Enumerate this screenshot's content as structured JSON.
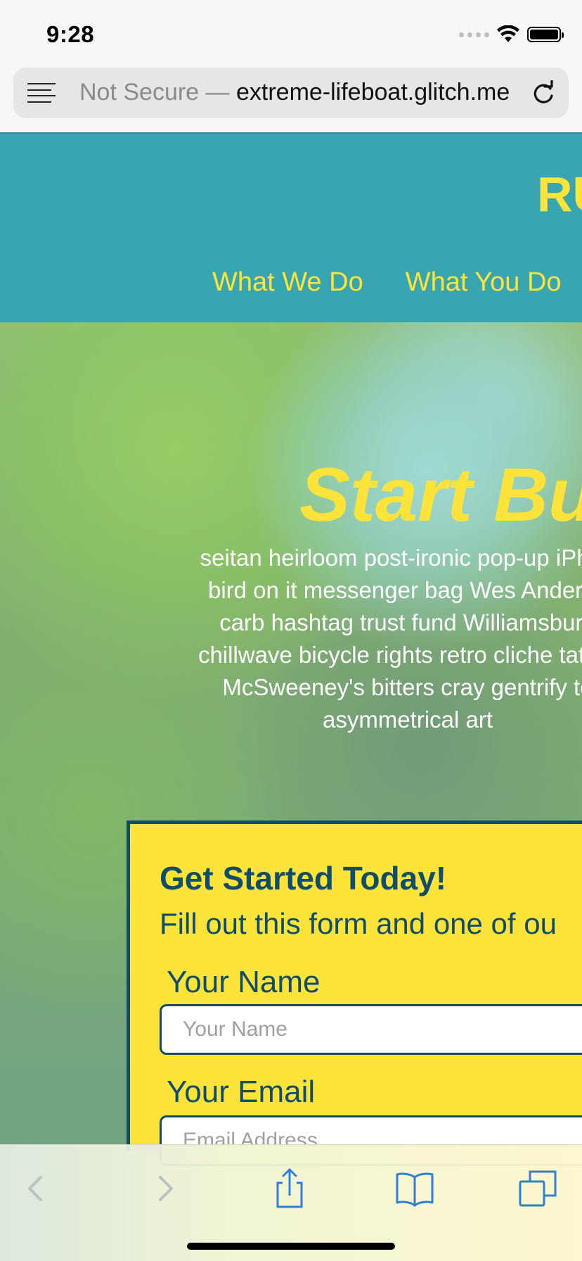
{
  "status_bar": {
    "time": "9:28"
  },
  "browser": {
    "url_prefix": "Not Secure — ",
    "url_domain": "extreme-lifeboat.glitch.me"
  },
  "site": {
    "brand": "RU",
    "nav": [
      "What We Do",
      "What You Do"
    ]
  },
  "hero": {
    "title": "Start Bu",
    "paragraph_lines": [
      "seitan heirloom post-ironic pop-up iPhon",
      "bird on it messenger bag Wes Anderso",
      "carb hashtag trust fund Williamsburg",
      "chillwave bicycle rights retro cliche tattoo",
      "McSweeney's bitters cray gentrify to",
      "asymmetrical art"
    ]
  },
  "form": {
    "title": "Get Started Today!",
    "subtitle": "Fill out this form and one of ou",
    "name_label": "Your Name",
    "name_placeholder": "Your Name",
    "email_label": "Your Email",
    "email_placeholder": "Email Address"
  },
  "colors": {
    "header_teal": "#38a6b1",
    "accent_yellow": "#fde33a",
    "form_navy": "#0f4d6b"
  },
  "toolbar": {
    "icons": [
      "back-icon",
      "forward-icon",
      "share-icon",
      "bookmarks-icon",
      "tabs-icon"
    ]
  }
}
